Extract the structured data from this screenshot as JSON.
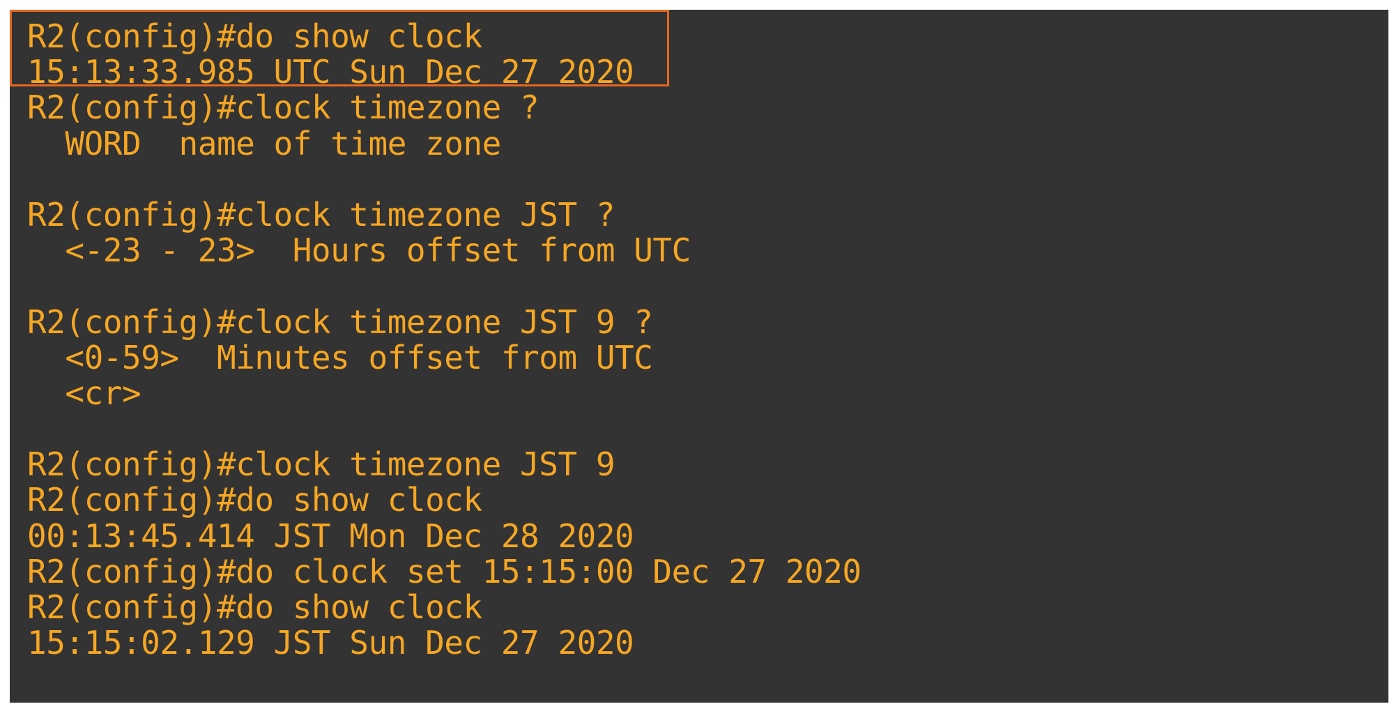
{
  "terminal": {
    "text_color": "#f5a623",
    "background_color": "#333333",
    "highlight_color": "#e8661e",
    "lines": [
      "R2(config)#do show clock",
      "15:13:33.985 UTC Sun Dec 27 2020",
      "R2(config)#clock timezone ?",
      "  WORD  name of time zone",
      "",
      "R2(config)#clock timezone JST ?",
      "  <-23 - 23>  Hours offset from UTC",
      "",
      "R2(config)#clock timezone JST 9 ?",
      "  <0-59>  Minutes offset from UTC",
      "  <cr>",
      "",
      "R2(config)#clock timezone JST 9",
      "R2(config)#do show clock",
      "00:13:45.414 JST Mon Dec 28 2020",
      "R2(config)#do clock set 15:15:00 Dec 27 2020",
      "R2(config)#do show clock",
      "15:15:02.129 JST Sun Dec 27 2020"
    ]
  }
}
